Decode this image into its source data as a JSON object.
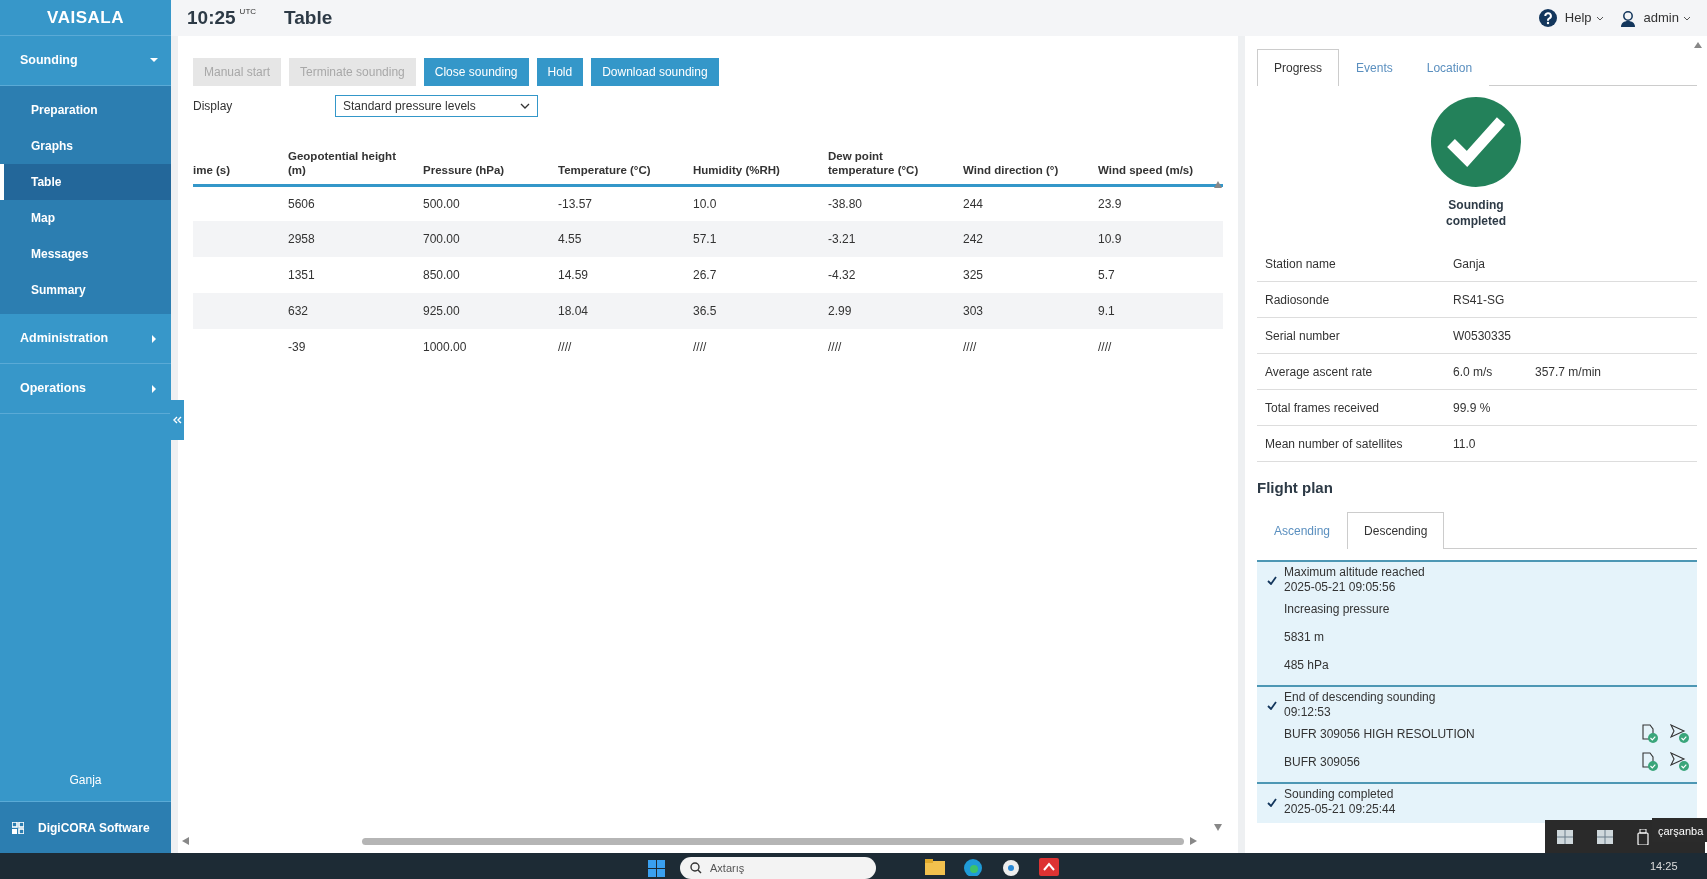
{
  "header": {
    "logo": "VAISALA",
    "time": "10:25",
    "time_zone": "UTC",
    "page_title": "Table",
    "help": "Help",
    "user": "admin"
  },
  "sidebar": {
    "sections": [
      {
        "label": "Sounding",
        "expanded": true,
        "children": [
          {
            "label": "Preparation",
            "selected": false
          },
          {
            "label": "Graphs",
            "selected": false
          },
          {
            "label": "Table",
            "selected": true
          },
          {
            "label": "Map",
            "selected": false
          },
          {
            "label": "Messages",
            "selected": false
          },
          {
            "label": "Summary",
            "selected": false
          }
        ]
      },
      {
        "label": "Administration",
        "expanded": false
      },
      {
        "label": "Operations",
        "expanded": false
      }
    ],
    "station": "Ganja",
    "footer": "DigiCORA Software"
  },
  "toolbar": {
    "buttons": [
      {
        "label": "Manual start",
        "disabled": true
      },
      {
        "label": "Terminate sounding",
        "disabled": true
      },
      {
        "label": "Close sounding",
        "disabled": false
      },
      {
        "label": "Hold",
        "disabled": false
      },
      {
        "label": "Download sounding",
        "disabled": false
      }
    ]
  },
  "display": {
    "label": "Display",
    "value": "Standard pressure levels"
  },
  "table": {
    "columns": [
      "ime (s)",
      "Geopotential height (m)",
      "Pressure (hPa)",
      "Temperature (°C)",
      "Humidity (%RH)",
      "Dew point temperature (°C)",
      "Wind direction (°)",
      "Wind speed (m/s)"
    ],
    "rows": [
      [
        "",
        "5606",
        "500.00",
        "-13.57",
        "10.0",
        "-38.80",
        "244",
        "23.9"
      ],
      [
        "",
        "2958",
        "700.00",
        "4.55",
        "57.1",
        "-3.21",
        "242",
        "10.9"
      ],
      [
        "",
        "1351",
        "850.00",
        "14.59",
        "26.7",
        "-4.32",
        "325",
        "5.7"
      ],
      [
        "",
        "632",
        "925.00",
        "18.04",
        "36.5",
        "2.99",
        "303",
        "9.1"
      ],
      [
        "",
        "-39",
        "1000.00",
        "////",
        "////",
        "////",
        "////",
        "////"
      ]
    ]
  },
  "right_panel": {
    "tabs": [
      {
        "label": "Progress",
        "selected": true
      },
      {
        "label": "Events",
        "selected": false
      },
      {
        "label": "Location",
        "selected": false
      }
    ],
    "status": {
      "text": "Sounding completed",
      "completed": true
    },
    "info": [
      {
        "label": "Station name",
        "values": [
          "Ganja"
        ]
      },
      {
        "label": "Radiosonde",
        "values": [
          "RS41-SG"
        ]
      },
      {
        "label": "Serial number",
        "values": [
          "W0530335"
        ]
      },
      {
        "label": "Average ascent rate",
        "values": [
          "6.0 m/s",
          "357.7 m/min"
        ]
      },
      {
        "label": "Total frames received",
        "values": [
          "99.9 %"
        ]
      },
      {
        "label": "Mean number of satellites",
        "values": [
          "11.0"
        ]
      }
    ],
    "flight_plan": {
      "title": "Flight plan",
      "tabs": [
        {
          "label": "Ascending",
          "selected": false
        },
        {
          "label": "Descending",
          "selected": true
        }
      ],
      "events": [
        {
          "title": "Maximum altitude reached",
          "time": "2025-05-21 09:05:56",
          "done": true,
          "details": [
            {
              "text": "Increasing pressure",
              "kind": "note"
            },
            {
              "text": "5831 m",
              "kind": "note"
            },
            {
              "text": "485 hPa",
              "kind": "note"
            }
          ]
        },
        {
          "title": "End of descending sounding",
          "time": "09:12:53",
          "done": true,
          "details": [
            {
              "text": "BUFR 309056 HIGH RESOLUTION",
              "kind": "message"
            },
            {
              "text": "BUFR 309056",
              "kind": "message"
            }
          ]
        },
        {
          "title": "Sounding completed",
          "time": "2025-05-21 09:25:44",
          "done": true
        }
      ]
    }
  },
  "taskbar": {
    "search_placeholder": "Axtarış",
    "clock": "14:25",
    "tooltip": "çarşanba"
  }
}
